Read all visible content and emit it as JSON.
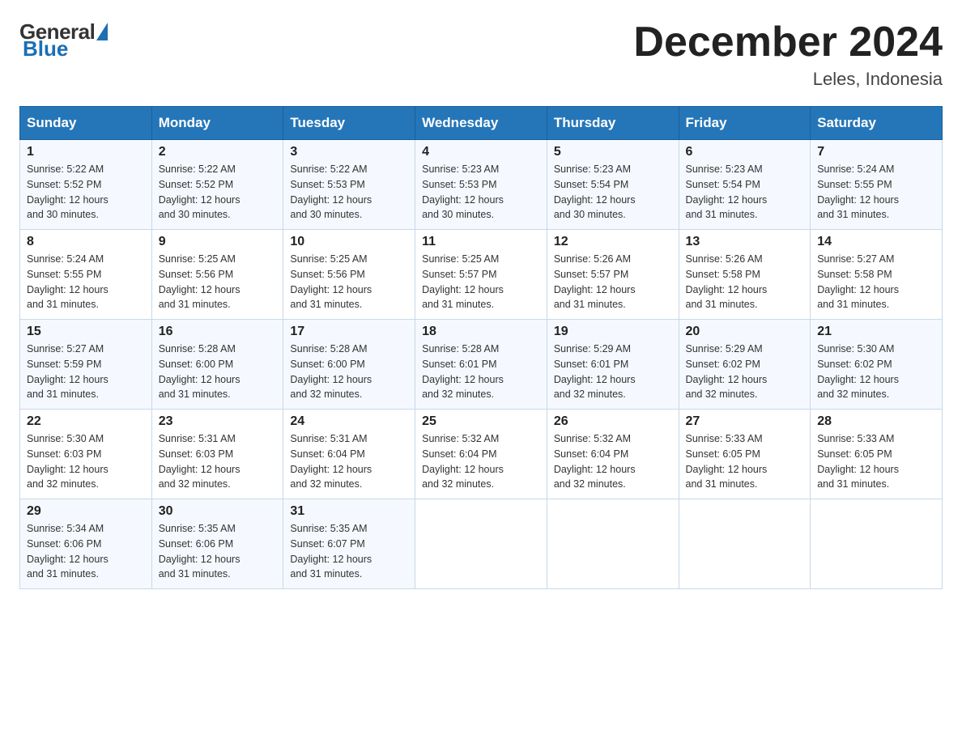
{
  "header": {
    "logo_general": "General",
    "logo_blue": "Blue",
    "month_title": "December 2024",
    "location": "Leles, Indonesia"
  },
  "days_of_week": [
    "Sunday",
    "Monday",
    "Tuesday",
    "Wednesday",
    "Thursday",
    "Friday",
    "Saturday"
  ],
  "weeks": [
    [
      {
        "day": "1",
        "info": "Sunrise: 5:22 AM\nSunset: 5:52 PM\nDaylight: 12 hours\nand 30 minutes."
      },
      {
        "day": "2",
        "info": "Sunrise: 5:22 AM\nSunset: 5:52 PM\nDaylight: 12 hours\nand 30 minutes."
      },
      {
        "day": "3",
        "info": "Sunrise: 5:22 AM\nSunset: 5:53 PM\nDaylight: 12 hours\nand 30 minutes."
      },
      {
        "day": "4",
        "info": "Sunrise: 5:23 AM\nSunset: 5:53 PM\nDaylight: 12 hours\nand 30 minutes."
      },
      {
        "day": "5",
        "info": "Sunrise: 5:23 AM\nSunset: 5:54 PM\nDaylight: 12 hours\nand 30 minutes."
      },
      {
        "day": "6",
        "info": "Sunrise: 5:23 AM\nSunset: 5:54 PM\nDaylight: 12 hours\nand 31 minutes."
      },
      {
        "day": "7",
        "info": "Sunrise: 5:24 AM\nSunset: 5:55 PM\nDaylight: 12 hours\nand 31 minutes."
      }
    ],
    [
      {
        "day": "8",
        "info": "Sunrise: 5:24 AM\nSunset: 5:55 PM\nDaylight: 12 hours\nand 31 minutes."
      },
      {
        "day": "9",
        "info": "Sunrise: 5:25 AM\nSunset: 5:56 PM\nDaylight: 12 hours\nand 31 minutes."
      },
      {
        "day": "10",
        "info": "Sunrise: 5:25 AM\nSunset: 5:56 PM\nDaylight: 12 hours\nand 31 minutes."
      },
      {
        "day": "11",
        "info": "Sunrise: 5:25 AM\nSunset: 5:57 PM\nDaylight: 12 hours\nand 31 minutes."
      },
      {
        "day": "12",
        "info": "Sunrise: 5:26 AM\nSunset: 5:57 PM\nDaylight: 12 hours\nand 31 minutes."
      },
      {
        "day": "13",
        "info": "Sunrise: 5:26 AM\nSunset: 5:58 PM\nDaylight: 12 hours\nand 31 minutes."
      },
      {
        "day": "14",
        "info": "Sunrise: 5:27 AM\nSunset: 5:58 PM\nDaylight: 12 hours\nand 31 minutes."
      }
    ],
    [
      {
        "day": "15",
        "info": "Sunrise: 5:27 AM\nSunset: 5:59 PM\nDaylight: 12 hours\nand 31 minutes."
      },
      {
        "day": "16",
        "info": "Sunrise: 5:28 AM\nSunset: 6:00 PM\nDaylight: 12 hours\nand 31 minutes."
      },
      {
        "day": "17",
        "info": "Sunrise: 5:28 AM\nSunset: 6:00 PM\nDaylight: 12 hours\nand 32 minutes."
      },
      {
        "day": "18",
        "info": "Sunrise: 5:28 AM\nSunset: 6:01 PM\nDaylight: 12 hours\nand 32 minutes."
      },
      {
        "day": "19",
        "info": "Sunrise: 5:29 AM\nSunset: 6:01 PM\nDaylight: 12 hours\nand 32 minutes."
      },
      {
        "day": "20",
        "info": "Sunrise: 5:29 AM\nSunset: 6:02 PM\nDaylight: 12 hours\nand 32 minutes."
      },
      {
        "day": "21",
        "info": "Sunrise: 5:30 AM\nSunset: 6:02 PM\nDaylight: 12 hours\nand 32 minutes."
      }
    ],
    [
      {
        "day": "22",
        "info": "Sunrise: 5:30 AM\nSunset: 6:03 PM\nDaylight: 12 hours\nand 32 minutes."
      },
      {
        "day": "23",
        "info": "Sunrise: 5:31 AM\nSunset: 6:03 PM\nDaylight: 12 hours\nand 32 minutes."
      },
      {
        "day": "24",
        "info": "Sunrise: 5:31 AM\nSunset: 6:04 PM\nDaylight: 12 hours\nand 32 minutes."
      },
      {
        "day": "25",
        "info": "Sunrise: 5:32 AM\nSunset: 6:04 PM\nDaylight: 12 hours\nand 32 minutes."
      },
      {
        "day": "26",
        "info": "Sunrise: 5:32 AM\nSunset: 6:04 PM\nDaylight: 12 hours\nand 32 minutes."
      },
      {
        "day": "27",
        "info": "Sunrise: 5:33 AM\nSunset: 6:05 PM\nDaylight: 12 hours\nand 31 minutes."
      },
      {
        "day": "28",
        "info": "Sunrise: 5:33 AM\nSunset: 6:05 PM\nDaylight: 12 hours\nand 31 minutes."
      }
    ],
    [
      {
        "day": "29",
        "info": "Sunrise: 5:34 AM\nSunset: 6:06 PM\nDaylight: 12 hours\nand 31 minutes."
      },
      {
        "day": "30",
        "info": "Sunrise: 5:35 AM\nSunset: 6:06 PM\nDaylight: 12 hours\nand 31 minutes."
      },
      {
        "day": "31",
        "info": "Sunrise: 5:35 AM\nSunset: 6:07 PM\nDaylight: 12 hours\nand 31 minutes."
      },
      {
        "day": "",
        "info": ""
      },
      {
        "day": "",
        "info": ""
      },
      {
        "day": "",
        "info": ""
      },
      {
        "day": "",
        "info": ""
      }
    ]
  ]
}
